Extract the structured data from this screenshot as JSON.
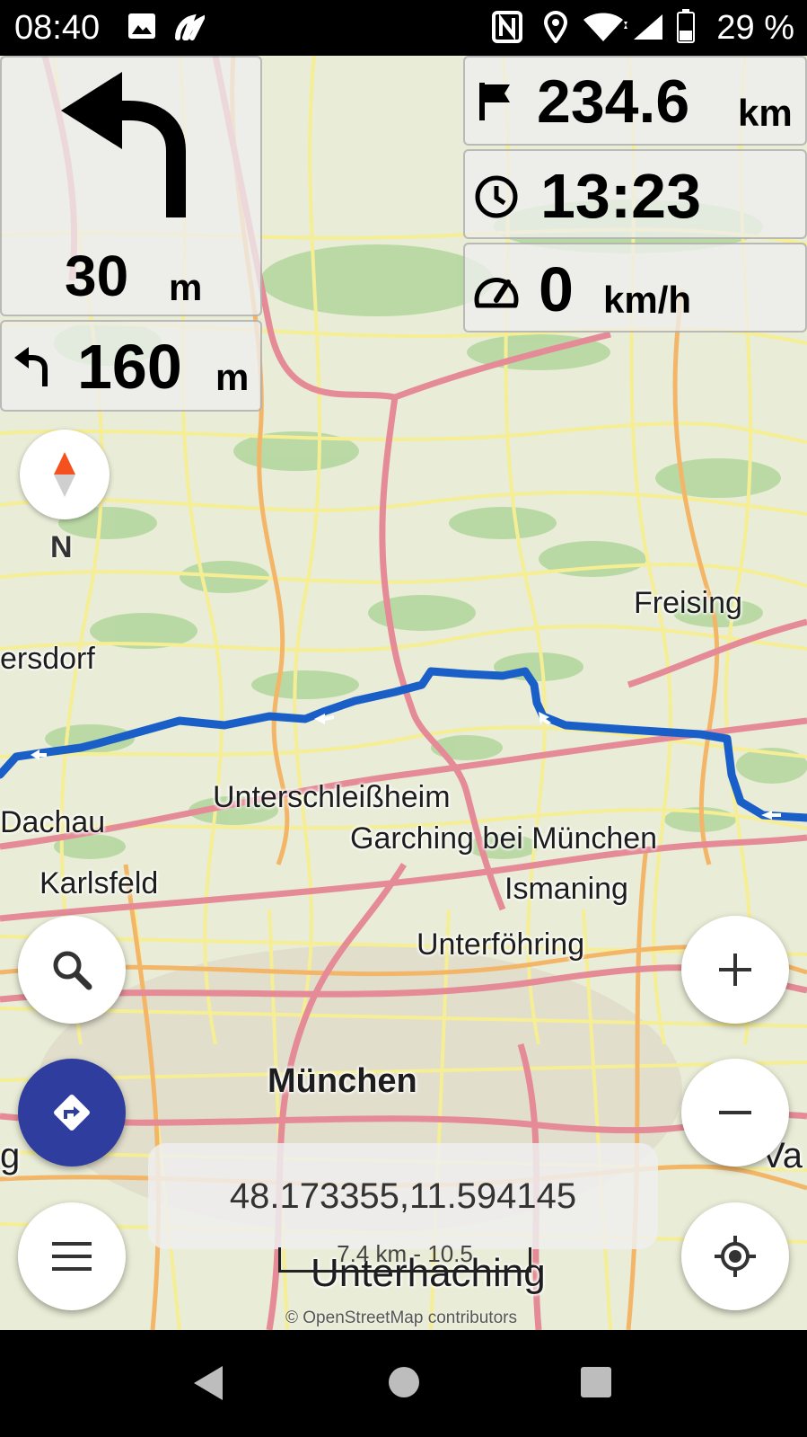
{
  "status_bar": {
    "time": "08:40",
    "battery": "29 %",
    "icons": [
      "image-icon",
      "app-icon",
      "nfc-icon",
      "location-icon",
      "wifi-icon",
      "signal-icon",
      "battery-icon"
    ]
  },
  "turn_widget": {
    "icon": "turn-left-arrow-icon",
    "distance_value": "30",
    "distance_unit": "m"
  },
  "next_turn_widget": {
    "icon": "turn-left-small-icon",
    "distance_value": "160",
    "distance_unit": "m"
  },
  "stats": {
    "remaining_distance": {
      "icon": "flag-icon",
      "value": "234.6",
      "unit": "km"
    },
    "arrival_time": {
      "icon": "clock-icon",
      "value": "13:23"
    },
    "speed": {
      "icon": "speedometer-icon",
      "value": "0",
      "unit": "km/h"
    }
  },
  "compass": {
    "label": "N"
  },
  "places": {
    "freising": "Freising",
    "ersdorf": "ersdorf",
    "dachau": "Dachau",
    "unterschleissheim": "Unterschleißheim",
    "garching": "Garching bei München",
    "karlsfeld": "Karlsfeld",
    "ismaning": "Ismaning",
    "unterfoehring": "Unterföhring",
    "muenchen": "München",
    "unterhaching": "Unterhaching",
    "g_edge": "g",
    "va_edge": "Va"
  },
  "coordinates": "48.173355,11.594145",
  "scale": "7.4 km - 10.5",
  "attribution": "© OpenStreetMap contributors",
  "colors": {
    "route": "#1a5fc8",
    "primary_road": "#e8919e",
    "secondary_road": "#f5c17a",
    "minor_road": "#f7f2a0",
    "forest": "#9fce8c",
    "land": "#e9ecd6",
    "fab_route": "#2f3e9e",
    "compass_north": "#f4511e"
  }
}
